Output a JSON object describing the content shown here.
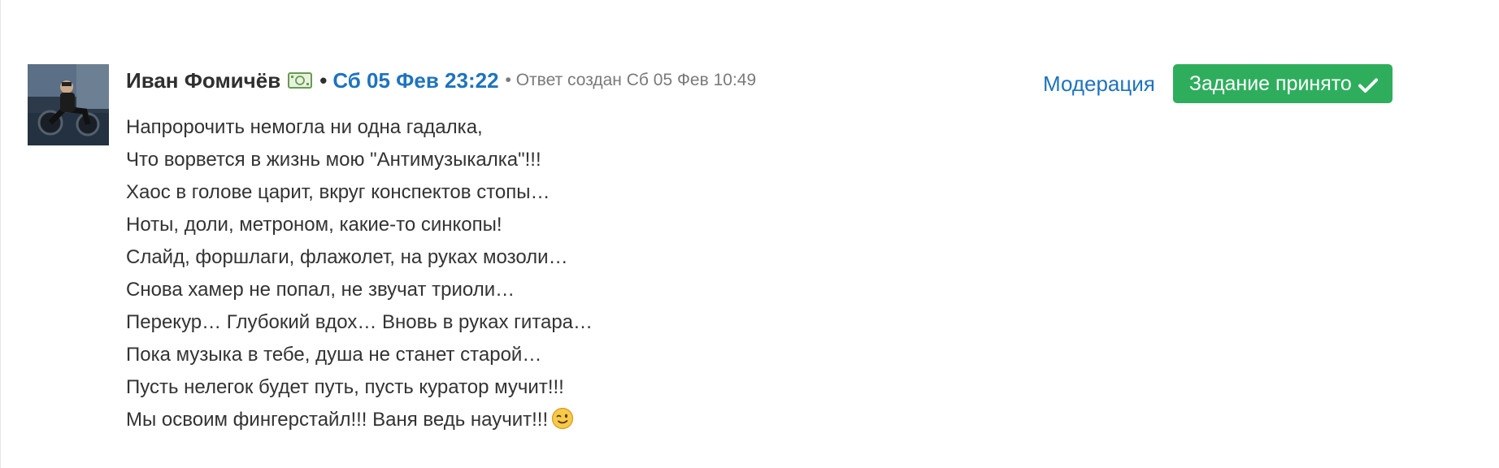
{
  "comment": {
    "author": "Иван Фомичёв",
    "separator": "•",
    "date": "Сб 05 Фев 23:22",
    "created_text": "• Ответ создан Сб 05 Фев 10:49",
    "poem_lines": [
      "Напророчить немогла ни одна гадалка,",
      "Что ворвется в жизнь мою \"Антимузыкалка\"!!!",
      "Хаос в голове царит, вкруг конспектов стопы…",
      "Ноты, доли, метроном, какие-то синкопы!",
      "Слайд, форшлаги, флажолет, на руках мозоли…",
      "Снова хамер не попал, не звучат триоли…",
      "Перекур… Глубокий вдох… Вновь в руках гитара…",
      "Пока музыка в тебе, душа не станет старой…",
      "Пусть нелегок будет путь, пусть куратор мучит!!!",
      "Мы освоим фингерстайл!!! Ваня ведь научит!!!"
    ],
    "icons": {
      "author_badge": "money-icon",
      "last_line_emoji": "wink-emoji-icon",
      "accepted": "check-icon"
    }
  },
  "actions": {
    "moderation_label": "Модерация",
    "accepted_label": "Задание принято"
  },
  "colors": {
    "link": "#1e73be",
    "accepted_button": "#2eae5d",
    "meta_gray": "#7a7a7a",
    "text": "#333333"
  }
}
